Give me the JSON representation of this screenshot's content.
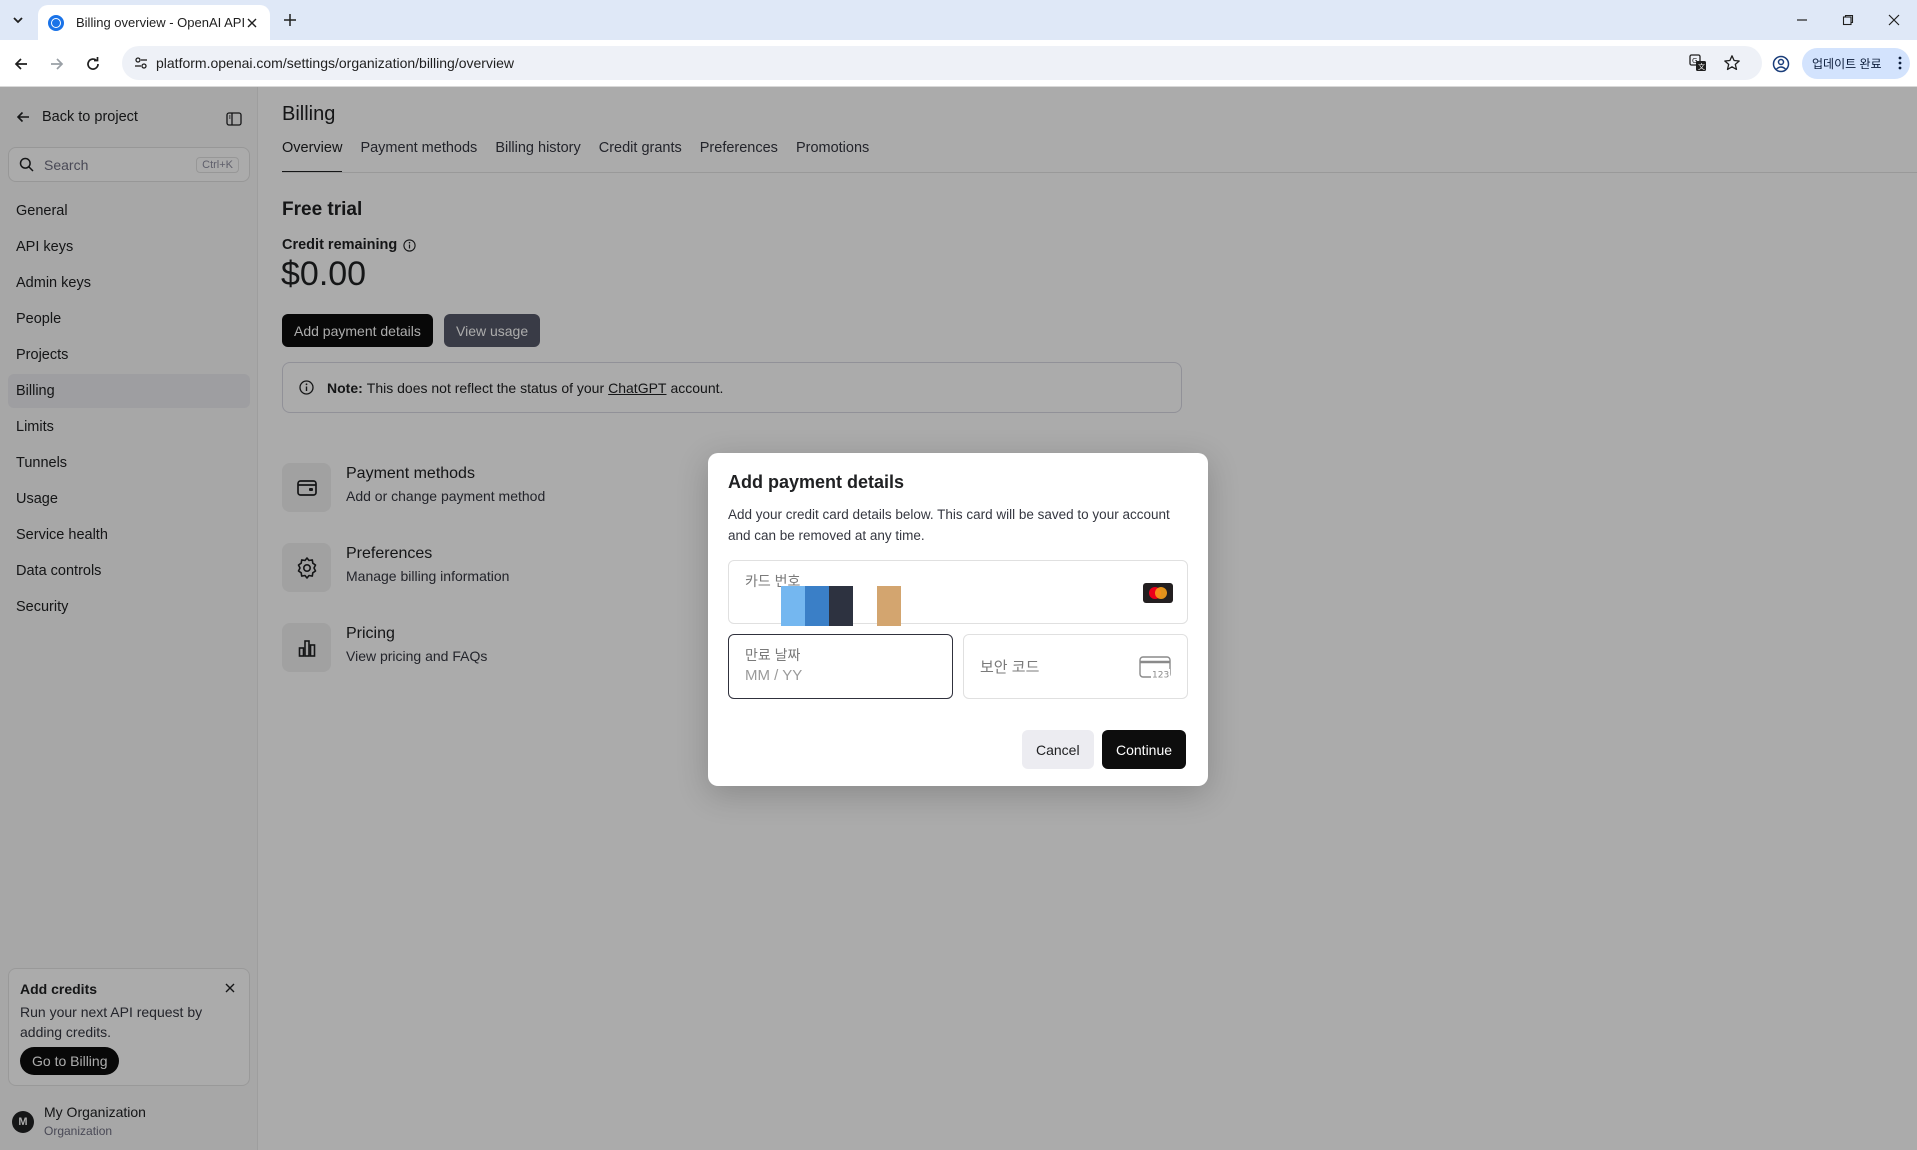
{
  "browser": {
    "tab_title": "Billing overview - OpenAI API",
    "url": "platform.openai.com/settings/organization/billing/overview",
    "update_label": "업데이트 완료"
  },
  "sidebar": {
    "back_label": "Back to project",
    "search_placeholder": "Search",
    "search_shortcut": "Ctrl+K",
    "items": [
      {
        "label": "General"
      },
      {
        "label": "API keys"
      },
      {
        "label": "Admin keys"
      },
      {
        "label": "People"
      },
      {
        "label": "Projects"
      },
      {
        "label": "Billing",
        "active": true
      },
      {
        "label": "Limits"
      },
      {
        "label": "Tunnels"
      },
      {
        "label": "Usage"
      },
      {
        "label": "Service health"
      },
      {
        "label": "Data controls"
      },
      {
        "label": "Security"
      }
    ],
    "promo": {
      "title": "Add credits",
      "text": "Run your next API request by adding credits.",
      "button": "Go to Billing"
    },
    "org": {
      "avatar": "M",
      "name": "My Organization",
      "role": "Organization"
    }
  },
  "main": {
    "title": "Billing",
    "tabs": [
      {
        "label": "Overview",
        "active": true
      },
      {
        "label": "Payment methods"
      },
      {
        "label": "Billing history"
      },
      {
        "label": "Credit grants"
      },
      {
        "label": "Preferences"
      },
      {
        "label": "Promotions"
      }
    ],
    "plan_title": "Free trial",
    "credit_label": "Credit remaining",
    "credit_amount": "$0.00",
    "add_payment_button": "Add payment details",
    "view_usage_button": "View usage",
    "note": {
      "prefix": "Note:",
      "text": "This does not reflect the status of your",
      "link": "ChatGPT",
      "suffix": "account."
    },
    "cards": [
      {
        "title": "Payment methods",
        "subtitle": "Add or change payment method",
        "icon": "wallet-icon"
      },
      {
        "title": "Preferences",
        "subtitle": "Manage billing information",
        "icon": "gear-icon"
      },
      {
        "title": "Pricing",
        "subtitle": "View pricing and FAQs",
        "icon": "bar-chart-icon"
      }
    ]
  },
  "modal": {
    "title": "Add payment details",
    "description": "Add your credit card details below. This card will be saved to your account and can be removed at any time.",
    "card_number_label": "카드 번호",
    "expiry_label": "만료 날짜",
    "expiry_placeholder": "MM / YY",
    "cvc_label": "보안 코드",
    "cvc_icon_text": "123",
    "cancel_button": "Cancel",
    "continue_button": "Continue"
  },
  "colors": {
    "accent_dark": "#0d0d0d",
    "secondary_button": "#565869",
    "overlay": "rgba(0,0,0,0.33)",
    "card_stripes": [
      "#74b7f0",
      "#3a7fc7",
      "#2d3240",
      "#d3a56f"
    ]
  }
}
